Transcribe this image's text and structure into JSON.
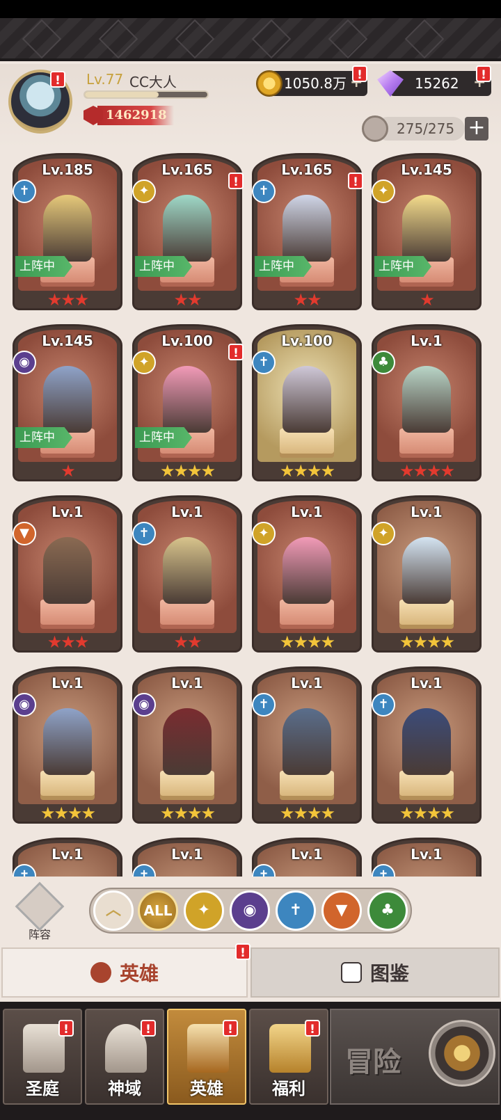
{
  "player": {
    "level": "Lv.77",
    "name": "CC大人",
    "xp_fraction": 0.6,
    "power": "1462918"
  },
  "currency": {
    "gold": "1050.8万",
    "gems": "15262",
    "stamina": "275/275",
    "plus": "+"
  },
  "heroes": [
    {
      "level": "Lv.185",
      "class_icon": "shield-class-icon",
      "deployed": "上阵中",
      "stars": "★★★",
      "star_color": "red",
      "quality": "red"
    },
    {
      "level": "Lv.165",
      "class_icon": "wing-class-icon",
      "deployed": "上阵中",
      "stars": "★★",
      "star_color": "red",
      "quality": "red"
    },
    {
      "level": "Lv.165",
      "class_icon": "shield-class-icon",
      "deployed": "上阵中",
      "stars": "★★",
      "star_color": "red",
      "quality": "red"
    },
    {
      "level": "Lv.145",
      "class_icon": "wing-class-icon",
      "deployed": "上阵中",
      "stars": "★",
      "star_color": "red",
      "quality": "red"
    },
    {
      "level": "Lv.145",
      "class_icon": "eye-class-icon",
      "deployed": "上阵中",
      "stars": "★",
      "star_color": "red",
      "quality": "red"
    },
    {
      "level": "Lv.100",
      "class_icon": "wing-class-icon",
      "deployed": "上阵中",
      "stars": "★★★★",
      "star_color": "gold",
      "quality": "red"
    },
    {
      "level": "Lv.100",
      "class_icon": "shield-class-icon",
      "deployed": "",
      "stars": "★★★★",
      "star_color": "gold",
      "quality": "gold"
    },
    {
      "level": "Lv.1",
      "class_icon": "tree-class-icon",
      "deployed": "",
      "stars": "★★★★",
      "star_color": "red",
      "quality": "red"
    },
    {
      "level": "Lv.1",
      "class_icon": "wolf-class-icon",
      "deployed": "",
      "stars": "★★★",
      "star_color": "red",
      "quality": "red"
    },
    {
      "level": "Lv.1",
      "class_icon": "shield-class-icon",
      "deployed": "",
      "stars": "★★",
      "star_color": "red",
      "quality": "red"
    },
    {
      "level": "Lv.1",
      "class_icon": "wing-class-icon",
      "deployed": "",
      "stars": "★★★★",
      "star_color": "gold",
      "quality": "red"
    },
    {
      "level": "Lv.1",
      "class_icon": "wing-class-icon",
      "deployed": "",
      "stars": "★★★★",
      "star_color": "gold",
      "quality": "brown"
    },
    {
      "level": "Lv.1",
      "class_icon": "eye-class-icon",
      "deployed": "",
      "stars": "★★★★",
      "star_color": "gold",
      "quality": "brown"
    },
    {
      "level": "Lv.1",
      "class_icon": "eye-class-icon",
      "deployed": "",
      "stars": "★★★★",
      "star_color": "gold",
      "quality": "brown"
    },
    {
      "level": "Lv.1",
      "class_icon": "shield-class-icon",
      "deployed": "",
      "stars": "★★★★",
      "star_color": "gold",
      "quality": "brown"
    },
    {
      "level": "Lv.1",
      "class_icon": "shield-class-icon",
      "deployed": "",
      "stars": "★★★★",
      "star_color": "gold",
      "quality": "brown"
    },
    {
      "level": "Lv.1",
      "class_icon": "shield-class-icon",
      "deployed": "",
      "stars": "",
      "star_color": "gold",
      "quality": "brown"
    },
    {
      "level": "Lv.1",
      "class_icon": "shield-class-icon",
      "deployed": "",
      "stars": "",
      "star_color": "gold",
      "quality": "brown"
    },
    {
      "level": "Lv.1",
      "class_icon": "shield-class-icon",
      "deployed": "",
      "stars": "",
      "star_color": "gold",
      "quality": "brown"
    },
    {
      "level": "Lv.1",
      "class_icon": "shield-class-icon",
      "deployed": "",
      "stars": "",
      "star_color": "gold",
      "quality": "brown"
    }
  ],
  "filter": {
    "lineup_label": "阵容",
    "all_label": "ALL",
    "buttons": [
      "up-arrow-icon",
      "all-filter",
      "wing-class-icon",
      "eye-class-icon",
      "shield-class-icon",
      "wolf-class-icon",
      "tree-class-icon"
    ]
  },
  "tabs": {
    "heroes": "英雄",
    "codex": "图鉴"
  },
  "nav": {
    "items": [
      {
        "label": "圣庭"
      },
      {
        "label": "神域"
      },
      {
        "label": "英雄"
      },
      {
        "label": "福利"
      }
    ],
    "adventure": "冒险"
  },
  "alert": "!",
  "colors": {
    "background": "#efe6df",
    "accent_red": "#e22b2b",
    "deploy_green": "#3c9a52",
    "star_red": "#e23a2e",
    "star_gold": "#f2c43a"
  }
}
